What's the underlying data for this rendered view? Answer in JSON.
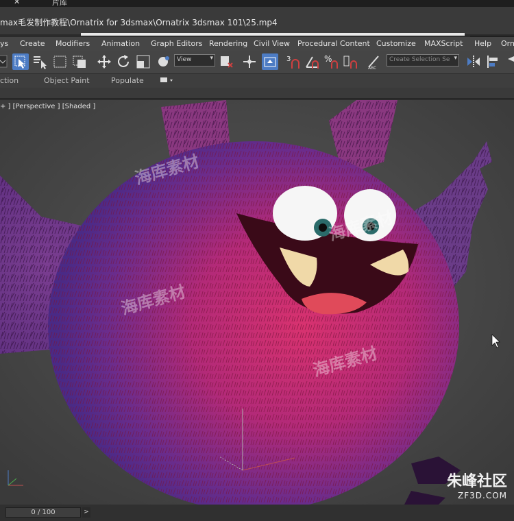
{
  "tabbar": {
    "close_glyph": "✕",
    "tab_label": "片库"
  },
  "window": {
    "title": "max毛发制作教程\\Ornatrix for 3dsmax\\Ornatrix 3dsmax 101\\25.mp4"
  },
  "menu": {
    "items": [
      "ys",
      "Create",
      "Modifiers",
      "Animation",
      "Graph Editors",
      "Rendering",
      "Civil View",
      "Procedural Content",
      "Customize",
      "MAXScript",
      "Help",
      "Orni"
    ]
  },
  "toolbar": {
    "view_dropdown": "View",
    "selection_set_placeholder": "Create Selection Se",
    "snap_label": "3",
    "angle_snap_icon": "angle-snap-icon",
    "percent_snap_icon": "percent-snap-icon",
    "accent_color": "#4d7cc4"
  },
  "ribbon": {
    "items": [
      "ction",
      "Object Paint",
      "Populate"
    ]
  },
  "viewport": {
    "label": "+ ] [Perspective ] [Shaded ]",
    "watermarks": [
      "海库素材",
      "海库素材",
      "海库素材",
      "海库素材"
    ]
  },
  "branding": {
    "name": "朱峰社区",
    "url": "ZF3D.COM"
  },
  "timeline": {
    "frame_display": "0 / 100",
    "next_glyph": ">"
  }
}
